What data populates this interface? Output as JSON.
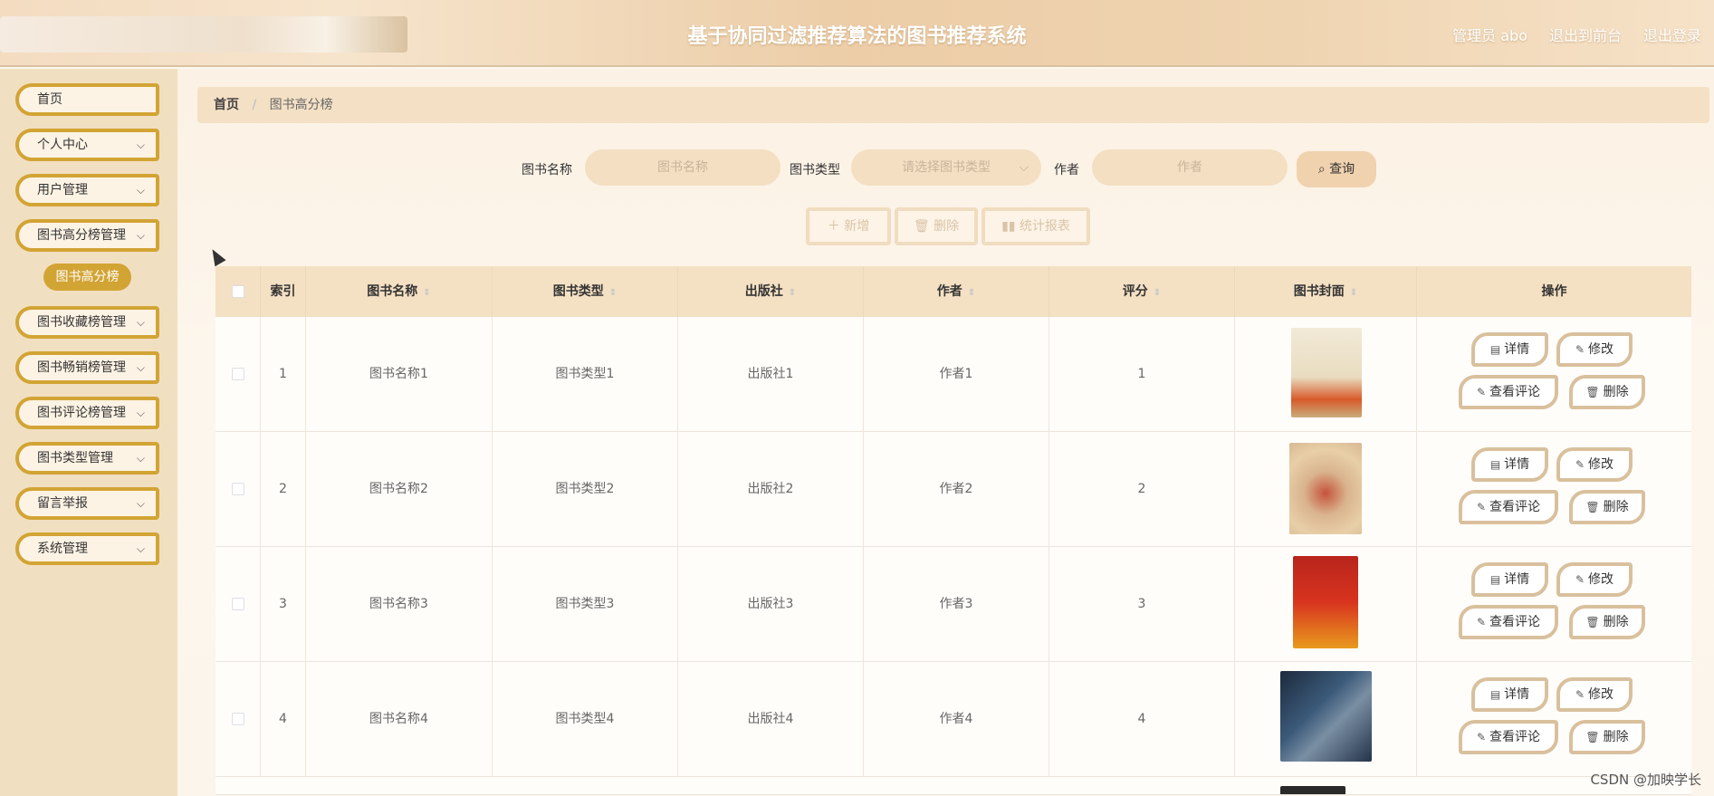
{
  "header": {
    "title": "基于协同过滤推荐算法的图书推荐系统",
    "admin_label": "管理员 abo",
    "to_front": "退出到前台",
    "logout": "退出登录"
  },
  "sidebar": {
    "items": [
      {
        "label": "首页"
      },
      {
        "label": "个人中心"
      },
      {
        "label": "用户管理"
      },
      {
        "label": "图书高分榜管理"
      },
      {
        "label": "图书收藏榜管理"
      },
      {
        "label": "图书畅销榜管理"
      },
      {
        "label": "图书评论榜管理"
      },
      {
        "label": "图书类型管理"
      },
      {
        "label": "留言举报"
      },
      {
        "label": "系统管理"
      }
    ],
    "active_sub": "图书高分榜"
  },
  "breadcrumb": {
    "home": "首页",
    "sep": "/",
    "current": "图书高分榜"
  },
  "search": {
    "name_label": "图书名称",
    "name_placeholder": "图书名称",
    "type_label": "图书类型",
    "type_placeholder": "请选择图书类型",
    "author_label": "作者",
    "author_placeholder": "作者",
    "query_button": "查询"
  },
  "actions": {
    "add": "新增",
    "delete": "删除",
    "report": "统计报表"
  },
  "table": {
    "headers": [
      "索引",
      "图书名称",
      "图书类型",
      "出版社",
      "作者",
      "评分",
      "图书封面",
      "操作"
    ],
    "rows": [
      {
        "index": "1",
        "name": "图书名称1",
        "type": "图书类型1",
        "publisher": "出版社1",
        "author": "作者1",
        "score": "1"
      },
      {
        "index": "2",
        "name": "图书名称2",
        "type": "图书类型2",
        "publisher": "出版社2",
        "author": "作者2",
        "score": "2"
      },
      {
        "index": "3",
        "name": "图书名称3",
        "type": "图书类型3",
        "publisher": "出版社3",
        "author": "作者3",
        "score": "3"
      },
      {
        "index": "4",
        "name": "图书名称4",
        "type": "图书类型4",
        "publisher": "出版社4",
        "author": "作者4",
        "score": "4"
      }
    ],
    "ops": {
      "detail": "详情",
      "edit": "修改",
      "comments": "查看评论",
      "remove": "删除"
    }
  },
  "watermark": "CSDN @加映学长"
}
